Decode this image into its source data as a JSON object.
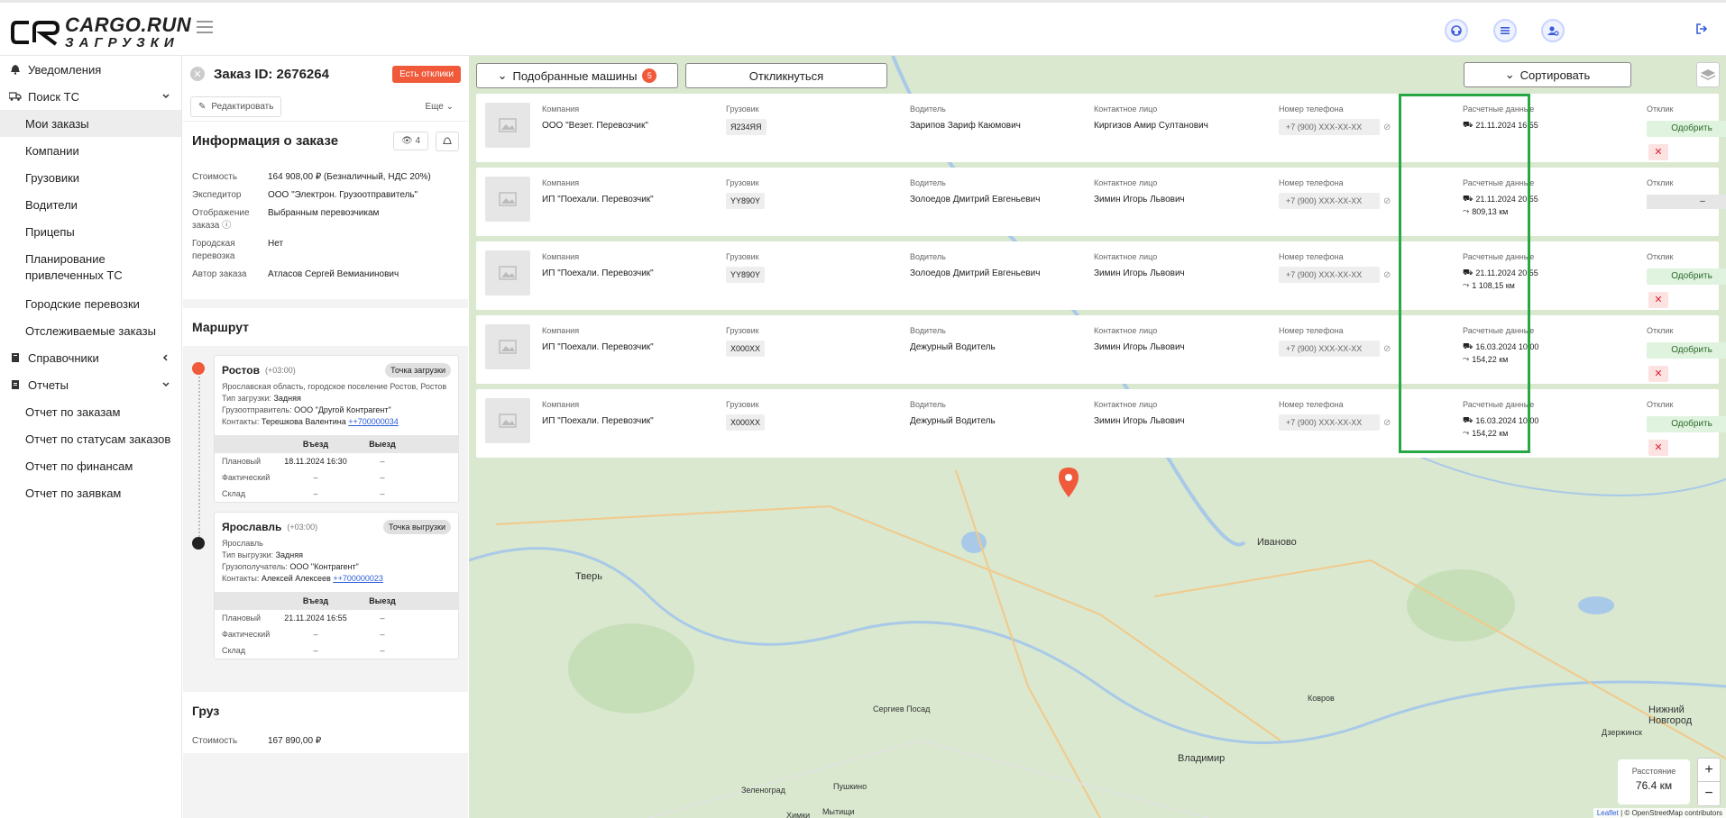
{
  "brand": {
    "title": "CARGO.RUN",
    "subtitle": "ЗАГРУЗКИ"
  },
  "sidebar": {
    "notifications": "Уведомления",
    "search": "Поиск ТС",
    "search_items": [
      "Мои заказы",
      "Компании",
      "Грузовики",
      "Водители",
      "Прицепы",
      "Планирование привлеченных ТС",
      "Городские перевозки",
      "Отслеживаемые заказы"
    ],
    "refs": "Справочники",
    "reports": "Отчеты",
    "report_items": [
      "Отчет по заказам",
      "Отчет по статусам заказов",
      "Отчет по финансам",
      "Отчет по заявкам"
    ]
  },
  "order": {
    "id_label": "Заказ ID: 2676264",
    "badge": "Есть отклики",
    "edit": "Редактировать",
    "more": "Еще",
    "info_title": "Информация о заказе",
    "views": "4",
    "fields": [
      {
        "k": "Стоимость",
        "v": "164 908,00 ₽ (Безналичный, НДС 20%)"
      },
      {
        "k": "Экспедитор",
        "v": "ООО \"Электрон. Грузоотправитель\""
      },
      {
        "k": "Отображение заказа",
        "v": "Выбранным перевозчикам"
      },
      {
        "k": "Городская перевозка",
        "v": "Нет"
      },
      {
        "k": "Автор заказа",
        "v": "Атласов Сергей Вемианинович"
      }
    ]
  },
  "route": {
    "title": "Маршрут",
    "stops": [
      {
        "city": "Ростов",
        "tz": "(+03:00)",
        "badge": "Точка загрузки",
        "address": "Ярославская область, городское поселение Ростов, Ростов",
        "type_label": "Тип загрузки:",
        "type": "Задняя",
        "party_label": "Грузоотправитель:",
        "party": "ООО \"Другой Контрагент\"",
        "contact_label": "Контакты:",
        "contact": "Терешкова Валентина",
        "phone": "++700000034",
        "col1": "Въезд",
        "col2": "Выезд",
        "rows": [
          [
            "Плановый",
            "18.11.2024 16:30",
            "–"
          ],
          [
            "Фактический",
            "–",
            "–"
          ],
          [
            "Склад",
            "–",
            "–"
          ]
        ]
      },
      {
        "city": "Ярославль",
        "tz": "(+03:00)",
        "badge": "Точка выгрузки",
        "address": "Ярославль",
        "type_label": "Тип выгрузки:",
        "type": "Задняя",
        "party_label": "Грузополучатель:",
        "party": "ООО \"Контрагент\"",
        "contact_label": "Контакты:",
        "contact": "Алексей Алексеев",
        "phone": "++700000023",
        "col1": "Въезд",
        "col2": "Выезд",
        "rows": [
          [
            "Плановый",
            "21.11.2024 16:55",
            "–"
          ],
          [
            "Фактический",
            "–",
            "–"
          ],
          [
            "Склад",
            "–",
            "–"
          ]
        ]
      }
    ]
  },
  "cargo": {
    "title": "Груз",
    "cost_label": "Стоимость",
    "cost": "167 890,00 ₽"
  },
  "toolbar": {
    "matched": "Подобранные машины",
    "matched_count": "5",
    "respond": "Откликнуться",
    "sort": "Сортировать"
  },
  "columns": {
    "company": "Компания",
    "truck": "Грузовик",
    "driver": "Водитель",
    "contact": "Контактное лицо",
    "phone": "Номер телефона",
    "calc": "Расчетные данные",
    "response": "Отклик"
  },
  "rows": [
    {
      "company": "ООО \"Везет. Перевозчик\"",
      "truck": "Я234ЯЯ",
      "driver": "Зарипов Зариф Каюмович",
      "contact": "Киргизов Амир Султанович",
      "phone": "+7 (900) XXX-XX-XX",
      "date": "21.11.2024 16:55",
      "dist": "",
      "action": "Одобрить"
    },
    {
      "company": "ИП \"Поехали. Перевозчик\"",
      "truck": "YY890Y",
      "driver": "Золоедов Дмитрий Евгеньевич",
      "contact": "Зимин Игорь Львович",
      "phone": "+7 (900) XXX-XX-XX",
      "date": "21.11.2024 20:55",
      "dist": "809,13 км",
      "action": "–"
    },
    {
      "company": "ИП \"Поехали. Перевозчик\"",
      "truck": "YY890Y",
      "driver": "Золоедов Дмитрий Евгеньевич",
      "contact": "Зимин Игорь Львович",
      "phone": "+7 (900) XXX-XX-XX",
      "date": "21.11.2024 20:55",
      "dist": "1 108,15 км",
      "action": "Одобрить"
    },
    {
      "company": "ИП \"Поехали. Перевозчик\"",
      "truck": "X000XX",
      "driver": "Дежурный Водитель",
      "contact": "Зимин Игорь Львович",
      "phone": "+7 (900) XXX-XX-XX",
      "date": "16.03.2024 10:00",
      "dist": "154,22 км",
      "action": "Одобрить"
    },
    {
      "company": "ИП \"Поехали. Перевозчик\"",
      "truck": "X000XX",
      "driver": "Дежурный Водитель",
      "contact": "Зимин Игорь Львович",
      "phone": "+7 (900) XXX-XX-XX",
      "date": "16.03.2024 10:00",
      "dist": "154,22 км",
      "action": "Одобрить"
    }
  ],
  "map": {
    "cities": [
      "Тверь",
      "Иваново",
      "Сергиев Посад",
      "Ковров",
      "Владимир",
      "Нижний Новгород",
      "Дзержинск",
      "Пушкино",
      "Зеленоград",
      "Химки",
      "Мытищи"
    ],
    "scale_label": "Расстояние",
    "scale_value": "76.4 км",
    "zoom_in": "+",
    "zoom_out": "−",
    "attrib_leaflet": "Leaflet",
    "attrib_osm": "| © OpenStreetMap contributors"
  },
  "colors": {
    "accent_red": "#f05a3a",
    "highlight_green": "#27a844",
    "approve_bg": "#dff3df"
  }
}
